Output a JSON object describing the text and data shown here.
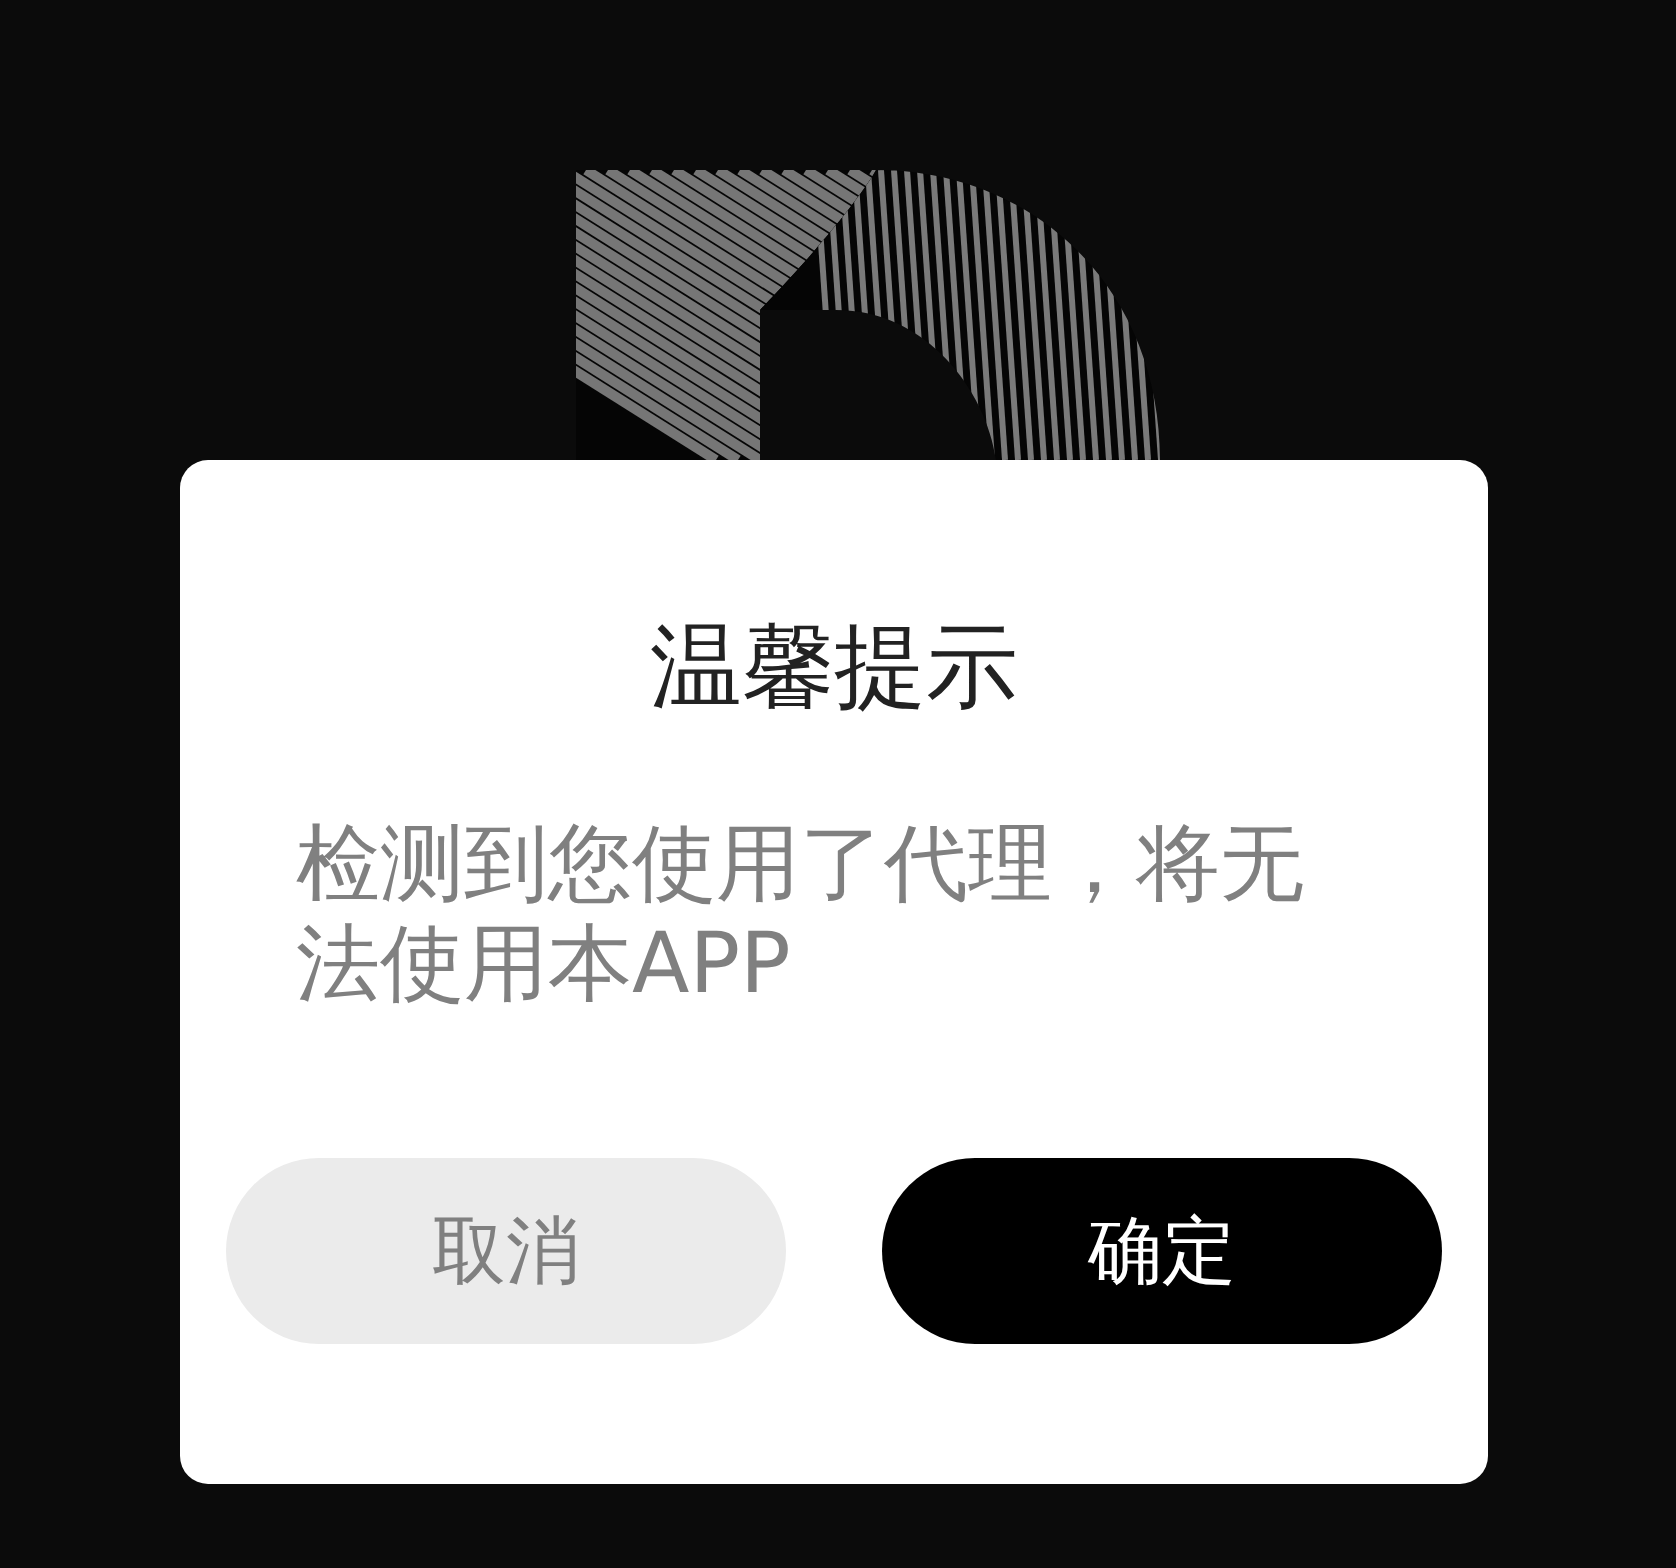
{
  "dialog": {
    "title": "温馨提示",
    "message": "检测到您使用了代理，将无法使用本APP",
    "buttons": [
      {
        "label": "取消",
        "kind": "secondary"
      },
      {
        "label": "确定",
        "kind": "primary"
      }
    ]
  }
}
